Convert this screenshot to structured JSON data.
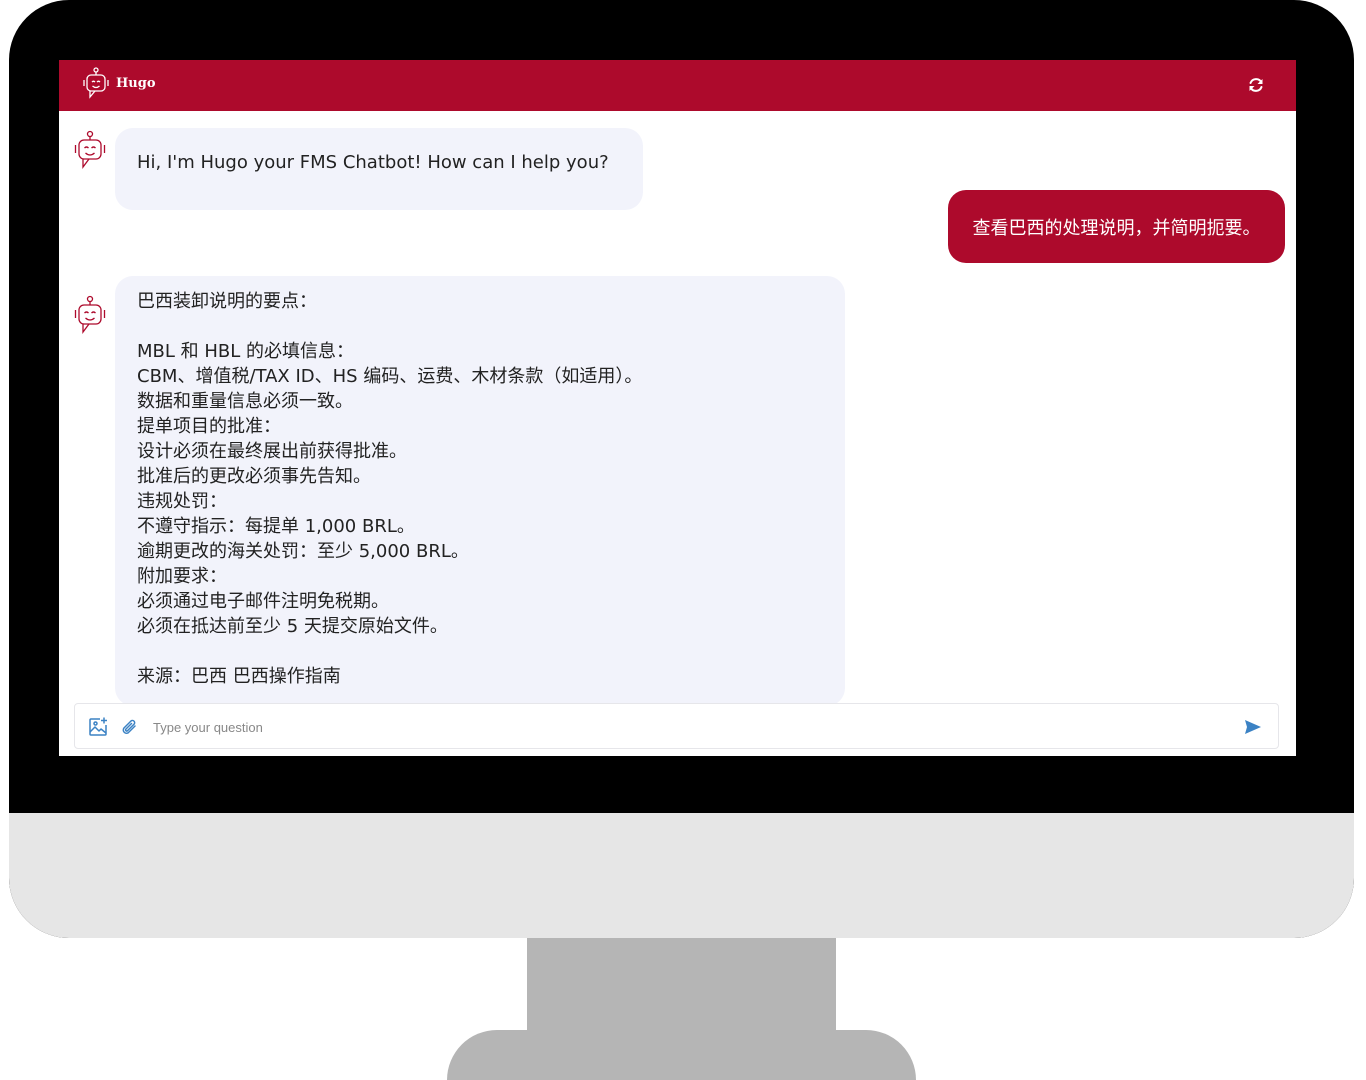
{
  "app": {
    "title": "Hugo"
  },
  "colors": {
    "brand": "#ad0a2c",
    "bot_bubble": "#f2f3fb",
    "send_icon": "#3b82c4"
  },
  "icons": {
    "header_logo": "robot-icon",
    "refresh": "refresh-icon",
    "bot_avatar": "robot-icon",
    "image_upload": "image-add-icon",
    "attach": "paperclip-icon",
    "send": "send-icon"
  },
  "messages": {
    "greeting": "Hi, I'm Hugo your FMS Chatbot! How can I help you?",
    "user_query": "查看巴西的处理说明，并简明扼要。",
    "answer_lines": [
      "巴西装卸说明的要点：",
      "",
      "MBL 和 HBL 的必填信息：",
      "CBM、增值税/TAX ID、HS 编码、运费、木材条款（如适用）。",
      "数据和重量信息必须一致。",
      "提单项目的批准：",
      "设计必须在最终展出前获得批准。",
      "批准后的更改必须事先告知。",
      "违规处罚：",
      "不遵守指示：每提单 1,000 BRL。",
      "逾期更改的海关处罚：至少 5,000 BRL。",
      "附加要求：",
      "必须通过电子邮件注明免税期。",
      "必须在抵达前至少 5 天提交原始文件。",
      "",
      "来源：巴西 巴西操作指南"
    ]
  },
  "input": {
    "placeholder": "Type your question",
    "value": ""
  }
}
